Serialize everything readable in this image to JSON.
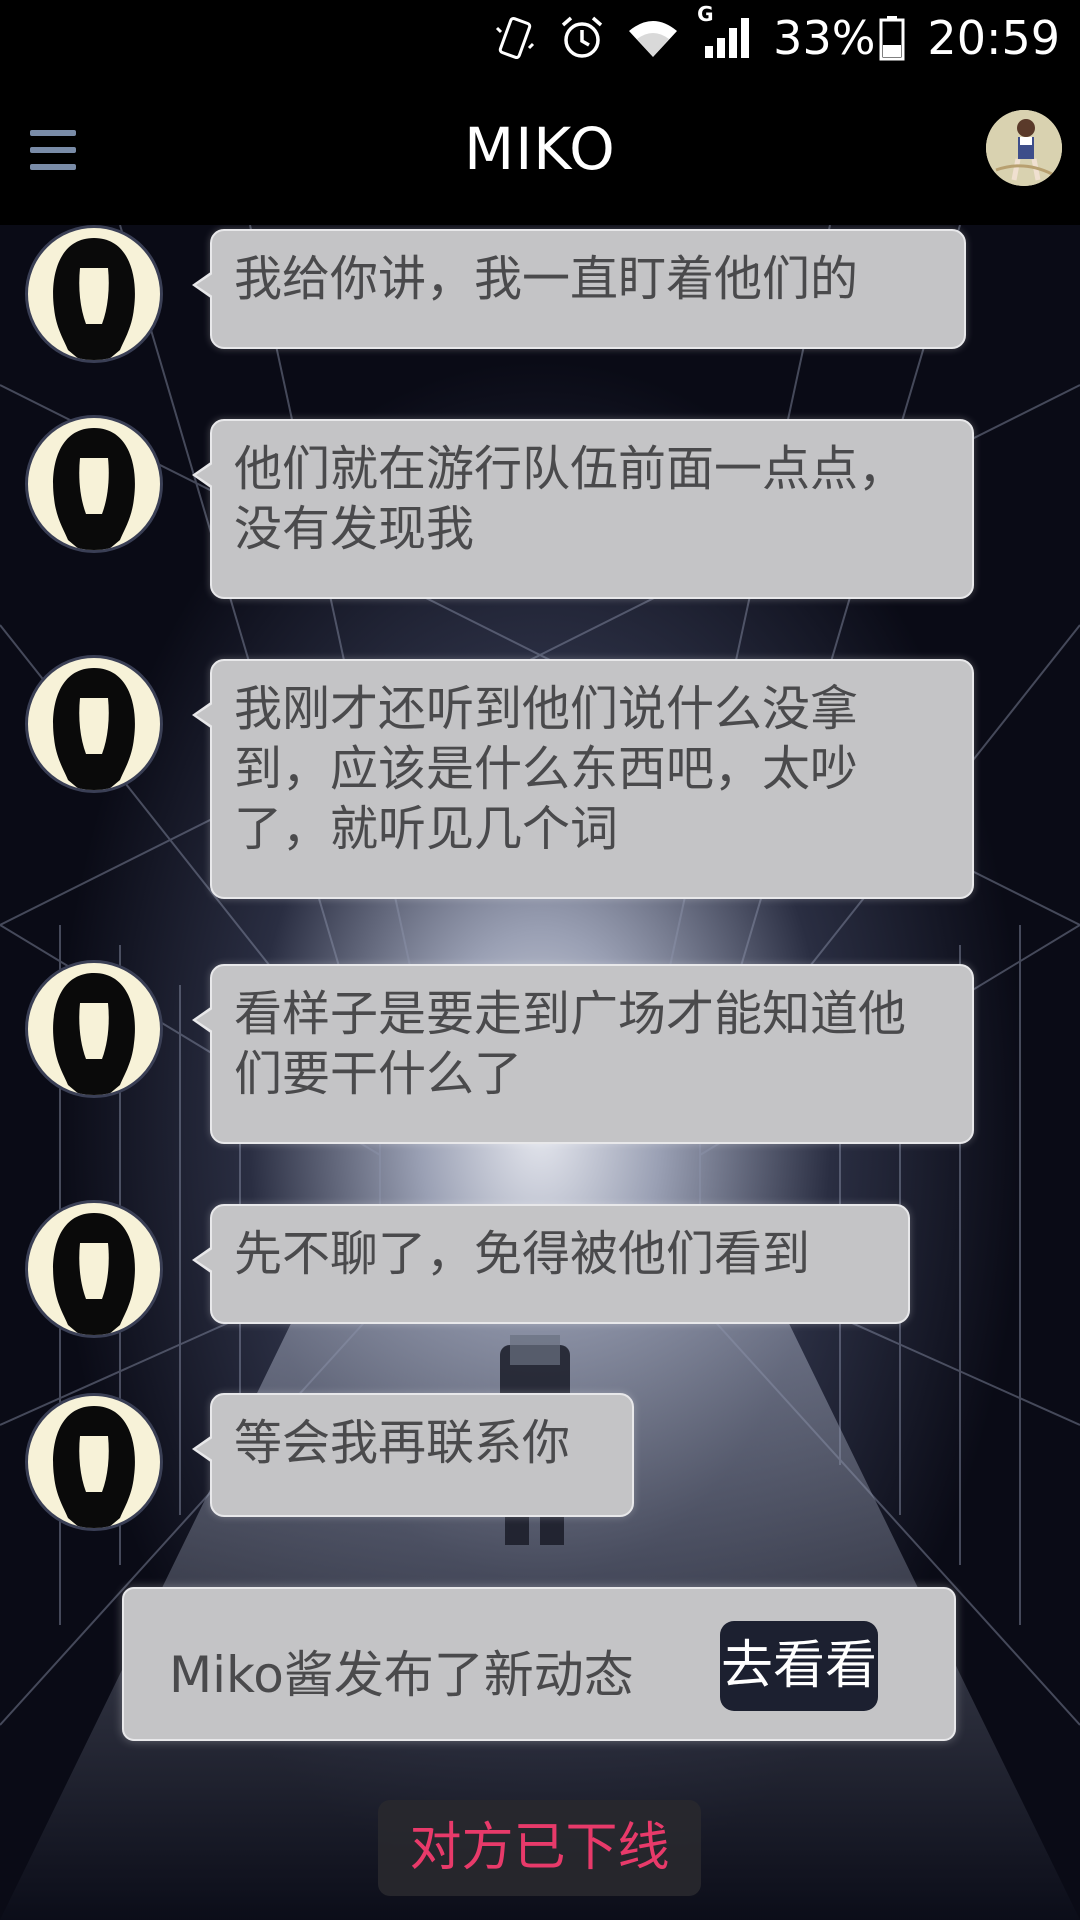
{
  "status_bar": {
    "battery_percent": "33%",
    "time": "20:59",
    "network_label": "G",
    "icons": [
      "vibrate-icon",
      "alarm-icon",
      "wifi-icon",
      "signal-icon",
      "battery-icon"
    ]
  },
  "app_bar": {
    "title": "MIKO",
    "menu_icon": "hamburger-menu-icon",
    "profile_icon": "profile-avatar"
  },
  "messages": [
    {
      "text": "我给你讲，我一直盯着他们的"
    },
    {
      "text": "他们就在游行队伍前面一点点，没有发现我"
    },
    {
      "text": "我刚才还听到他们说什么没拿到，应该是什么东西吧，太吵了，就听见几个词"
    },
    {
      "text": "看样子是要走到广场才能知道他们要干什么了"
    },
    {
      "text": "先不聊了，免得被他们看到"
    },
    {
      "text": "等会我再联系你"
    }
  ],
  "notice": {
    "text": "Miko酱发布了新动态",
    "button_label": "去看看"
  },
  "presence_status": "对方已下线",
  "colors": {
    "bubble": "#c4c4c6",
    "bubble_text": "#4a4a4c",
    "offline_text": "#e83a6a",
    "notice_button": "#1c2030"
  }
}
